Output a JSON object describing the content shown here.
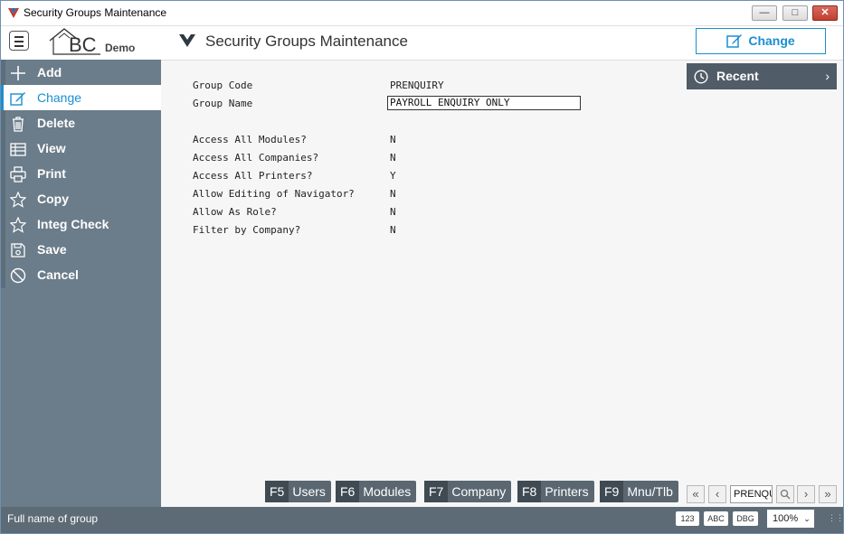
{
  "window": {
    "title": "Security Groups Maintenance"
  },
  "header": {
    "logo_text": "BC",
    "logo_sub": "Demo",
    "title": "Security Groups Maintenance",
    "action_label": "Change"
  },
  "sidebar": {
    "items": [
      {
        "label": "Add",
        "icon": "plus-icon"
      },
      {
        "label": "Change",
        "icon": "edit-icon",
        "active": true
      },
      {
        "label": "Delete",
        "icon": "trash-icon"
      },
      {
        "label": "View",
        "icon": "table-icon"
      },
      {
        "label": "Print",
        "icon": "printer-icon"
      },
      {
        "label": "Copy",
        "icon": "star-icon"
      },
      {
        "label": "Integ Check",
        "icon": "star-icon"
      },
      {
        "label": "Save",
        "icon": "save-icon"
      },
      {
        "label": "Cancel",
        "icon": "cancel-icon"
      }
    ]
  },
  "form": {
    "group_code_label": "Group Code",
    "group_code_value": "PRENQUIRY",
    "group_name_label": "Group Name",
    "group_name_value": "PAYROLL ENQUIRY ONLY",
    "fields": [
      {
        "label": "Access All Modules?",
        "value": "N"
      },
      {
        "label": "Access All Companies?",
        "value": "N"
      },
      {
        "label": "Access All Printers?",
        "value": "Y"
      },
      {
        "label": "Allow Editing of Navigator?",
        "value": "N"
      },
      {
        "label": "Allow As Role?",
        "value": "N"
      },
      {
        "label": "Filter by Company?",
        "value": "N"
      }
    ]
  },
  "recent": {
    "label": "Recent"
  },
  "fkeys": [
    {
      "key": "F5",
      "label": "Users"
    },
    {
      "key": "F6",
      "label": "Modules"
    },
    {
      "key": "F7",
      "label": "Company"
    },
    {
      "key": "F8",
      "label": "Printers"
    },
    {
      "key": "F9",
      "label": "Mnu/Tlb"
    }
  ],
  "record_nav": {
    "current": "PRENQUIRY"
  },
  "status": {
    "text": "Full name of group",
    "badges": [
      "123",
      "ABC",
      "DBG"
    ],
    "zoom": "100%"
  },
  "colors": {
    "accent": "#1a8fd0",
    "sidebar": "#6b7c8a",
    "statusbar": "#5d6b76"
  }
}
